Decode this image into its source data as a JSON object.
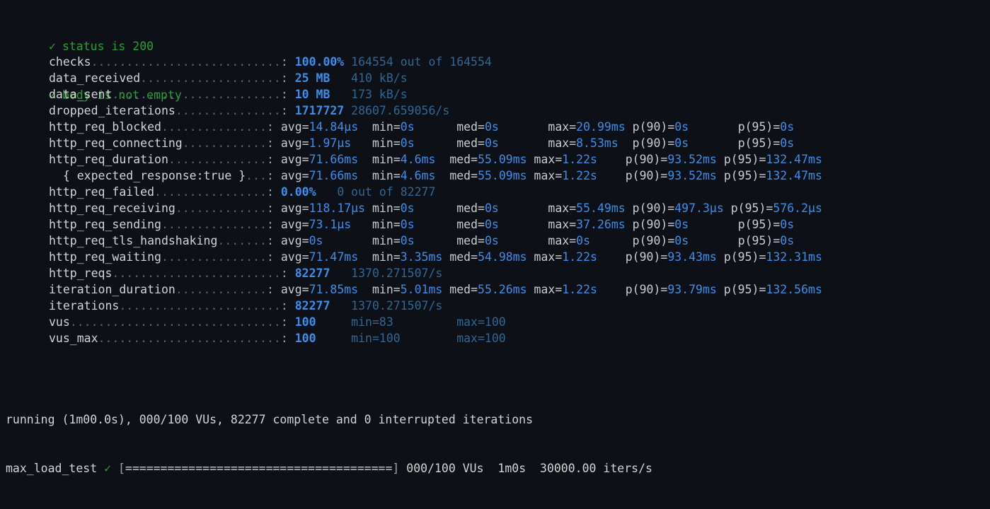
{
  "terminal": {
    "background": "#0d1117",
    "colors": {
      "green": "#23a233",
      "value_blue": "#3b8eea",
      "dim_blue": "#2f6894",
      "name_gray": "#d4d4d4",
      "dots_gray": "#5c6370"
    }
  },
  "checks": {
    "mark": "✓",
    "items": [
      {
        "label": "status is 200"
      },
      {
        "label": "body is not empty"
      }
    ]
  },
  "metrics": {
    "rows": [
      {
        "name": "checks",
        "leader": "...........................",
        "sep": ": ",
        "value": "100.00%",
        "extra": " 164554 out of 164554",
        "kind": "simple"
      },
      {
        "name": "data_received",
        "leader": "....................",
        "sep": ": ",
        "value": "25 MB",
        "extra": "   410 kB/s",
        "kind": "simple"
      },
      {
        "name": "data_sent",
        "leader": "........................",
        "sep": ": ",
        "value": "10 MB",
        "extra": "   173 kB/s",
        "kind": "simple"
      },
      {
        "name": "dropped_iterations",
        "leader": "...............",
        "sep": ": ",
        "value": "1717727",
        "extra": " 28607.659056/s",
        "kind": "simple"
      },
      {
        "name": "http_req_blocked",
        "leader": "...............",
        "sep": ": ",
        "kind": "trend",
        "stats": [
          {
            "key": "avg=",
            "val": "14.84µs",
            "pad": "  "
          },
          {
            "key": "min=",
            "val": "0s",
            "pad": "      "
          },
          {
            "key": "med=",
            "val": "0s",
            "pad": "       "
          },
          {
            "key": "max=",
            "val": "20.99ms",
            "pad": " "
          },
          {
            "key": "p(90)=",
            "val": "0s",
            "pad": "       "
          },
          {
            "key": "p(95)=",
            "val": "0s",
            "pad": ""
          }
        ]
      },
      {
        "name": "http_req_connecting",
        "leader": "............",
        "sep": ": ",
        "kind": "trend",
        "stats": [
          {
            "key": "avg=",
            "val": "1.97µs",
            "pad": "   "
          },
          {
            "key": "min=",
            "val": "0s",
            "pad": "      "
          },
          {
            "key": "med=",
            "val": "0s",
            "pad": "       "
          },
          {
            "key": "max=",
            "val": "8.53ms",
            "pad": "  "
          },
          {
            "key": "p(90)=",
            "val": "0s",
            "pad": "       "
          },
          {
            "key": "p(95)=",
            "val": "0s",
            "pad": ""
          }
        ]
      },
      {
        "name": "http_req_duration",
        "leader": "..............",
        "sep": ": ",
        "kind": "trend",
        "stats": [
          {
            "key": "avg=",
            "val": "71.66ms",
            "pad": "  "
          },
          {
            "key": "min=",
            "val": "4.6ms",
            "pad": "  "
          },
          {
            "key": "med=",
            "val": "55.09ms",
            "pad": " "
          },
          {
            "key": "max=",
            "val": "1.22s",
            "pad": "    "
          },
          {
            "key": "p(90)=",
            "val": "93.52ms",
            "pad": " "
          },
          {
            "key": "p(95)=",
            "val": "132.47ms",
            "pad": ""
          }
        ]
      },
      {
        "name": "  { expected_response:true }",
        "leader": "...",
        "sep": ": ",
        "kind": "trend",
        "stats": [
          {
            "key": "avg=",
            "val": "71.66ms",
            "pad": "  "
          },
          {
            "key": "min=",
            "val": "4.6ms",
            "pad": "  "
          },
          {
            "key": "med=",
            "val": "55.09ms",
            "pad": " "
          },
          {
            "key": "max=",
            "val": "1.22s",
            "pad": "    "
          },
          {
            "key": "p(90)=",
            "val": "93.52ms",
            "pad": " "
          },
          {
            "key": "p(95)=",
            "val": "132.47ms",
            "pad": ""
          }
        ]
      },
      {
        "name": "http_req_failed",
        "leader": "................",
        "sep": ": ",
        "value": "0.00%",
        "extra": "   0 out of 82277",
        "kind": "simple"
      },
      {
        "name": "http_req_receiving",
        "leader": ".............",
        "sep": ": ",
        "kind": "trend",
        "stats": [
          {
            "key": "avg=",
            "val": "118.17µs",
            "pad": " "
          },
          {
            "key": "min=",
            "val": "0s",
            "pad": "      "
          },
          {
            "key": "med=",
            "val": "0s",
            "pad": "       "
          },
          {
            "key": "max=",
            "val": "55.49ms",
            "pad": " "
          },
          {
            "key": "p(90)=",
            "val": "497.3µs",
            "pad": " "
          },
          {
            "key": "p(95)=",
            "val": "576.2µs",
            "pad": ""
          }
        ]
      },
      {
        "name": "http_req_sending",
        "leader": "...............",
        "sep": ": ",
        "kind": "trend",
        "stats": [
          {
            "key": "avg=",
            "val": "73.1µs",
            "pad": "   "
          },
          {
            "key": "min=",
            "val": "0s",
            "pad": "      "
          },
          {
            "key": "med=",
            "val": "0s",
            "pad": "       "
          },
          {
            "key": "max=",
            "val": "37.26ms",
            "pad": " "
          },
          {
            "key": "p(90)=",
            "val": "0s",
            "pad": "       "
          },
          {
            "key": "p(95)=",
            "val": "0s",
            "pad": ""
          }
        ]
      },
      {
        "name": "http_req_tls_handshaking",
        "leader": ".......",
        "sep": ": ",
        "kind": "trend",
        "stats": [
          {
            "key": "avg=",
            "val": "0s",
            "pad": "       "
          },
          {
            "key": "min=",
            "val": "0s",
            "pad": "      "
          },
          {
            "key": "med=",
            "val": "0s",
            "pad": "       "
          },
          {
            "key": "max=",
            "val": "0s",
            "pad": "      "
          },
          {
            "key": "p(90)=",
            "val": "0s",
            "pad": "       "
          },
          {
            "key": "p(95)=",
            "val": "0s",
            "pad": ""
          }
        ]
      },
      {
        "name": "http_req_waiting",
        "leader": "...............",
        "sep": ": ",
        "kind": "trend",
        "stats": [
          {
            "key": "avg=",
            "val": "71.47ms",
            "pad": "  "
          },
          {
            "key": "min=",
            "val": "3.35ms",
            "pad": " "
          },
          {
            "key": "med=",
            "val": "54.98ms",
            "pad": " "
          },
          {
            "key": "max=",
            "val": "1.22s",
            "pad": "    "
          },
          {
            "key": "p(90)=",
            "val": "93.43ms",
            "pad": " "
          },
          {
            "key": "p(95)=",
            "val": "132.31ms",
            "pad": ""
          }
        ]
      },
      {
        "name": "http_reqs",
        "leader": "........................",
        "sep": ": ",
        "value": "82277",
        "extra": "   1370.271507/s",
        "kind": "simple"
      },
      {
        "name": "iteration_duration",
        "leader": ".............",
        "sep": ": ",
        "kind": "trend",
        "stats": [
          {
            "key": "avg=",
            "val": "71.85ms",
            "pad": "  "
          },
          {
            "key": "min=",
            "val": "5.01ms",
            "pad": " "
          },
          {
            "key": "med=",
            "val": "55.26ms",
            "pad": " "
          },
          {
            "key": "max=",
            "val": "1.22s",
            "pad": "    "
          },
          {
            "key": "p(90)=",
            "val": "93.79ms",
            "pad": " "
          },
          {
            "key": "p(95)=",
            "val": "132.56ms",
            "pad": ""
          }
        ]
      },
      {
        "name": "iterations",
        "leader": ".......................",
        "sep": ": ",
        "value": "82277",
        "extra": "   1370.271507/s",
        "kind": "simple"
      },
      {
        "name": "vus",
        "leader": "..............................",
        "sep": ": ",
        "value": "100",
        "extra": "     min=83         max=100",
        "kind": "simple"
      },
      {
        "name": "vus_max",
        "leader": "..........................",
        "sep": ": ",
        "value": "100",
        "extra": "     min=100        max=100",
        "kind": "simple"
      }
    ]
  },
  "footer": {
    "running_line": {
      "prefix": "running (1m00.0s), 000/100 VUs, 82277 complete and 0 interrupted iterations"
    },
    "progress_line": {
      "scenario": "max_load_test ",
      "mark": "✓",
      "bracket_open": " [",
      "bar": "======================================",
      "bracket_close": "] ",
      "suffix": "000/100 VUs  1m0s  30000.00 iters/s"
    }
  }
}
